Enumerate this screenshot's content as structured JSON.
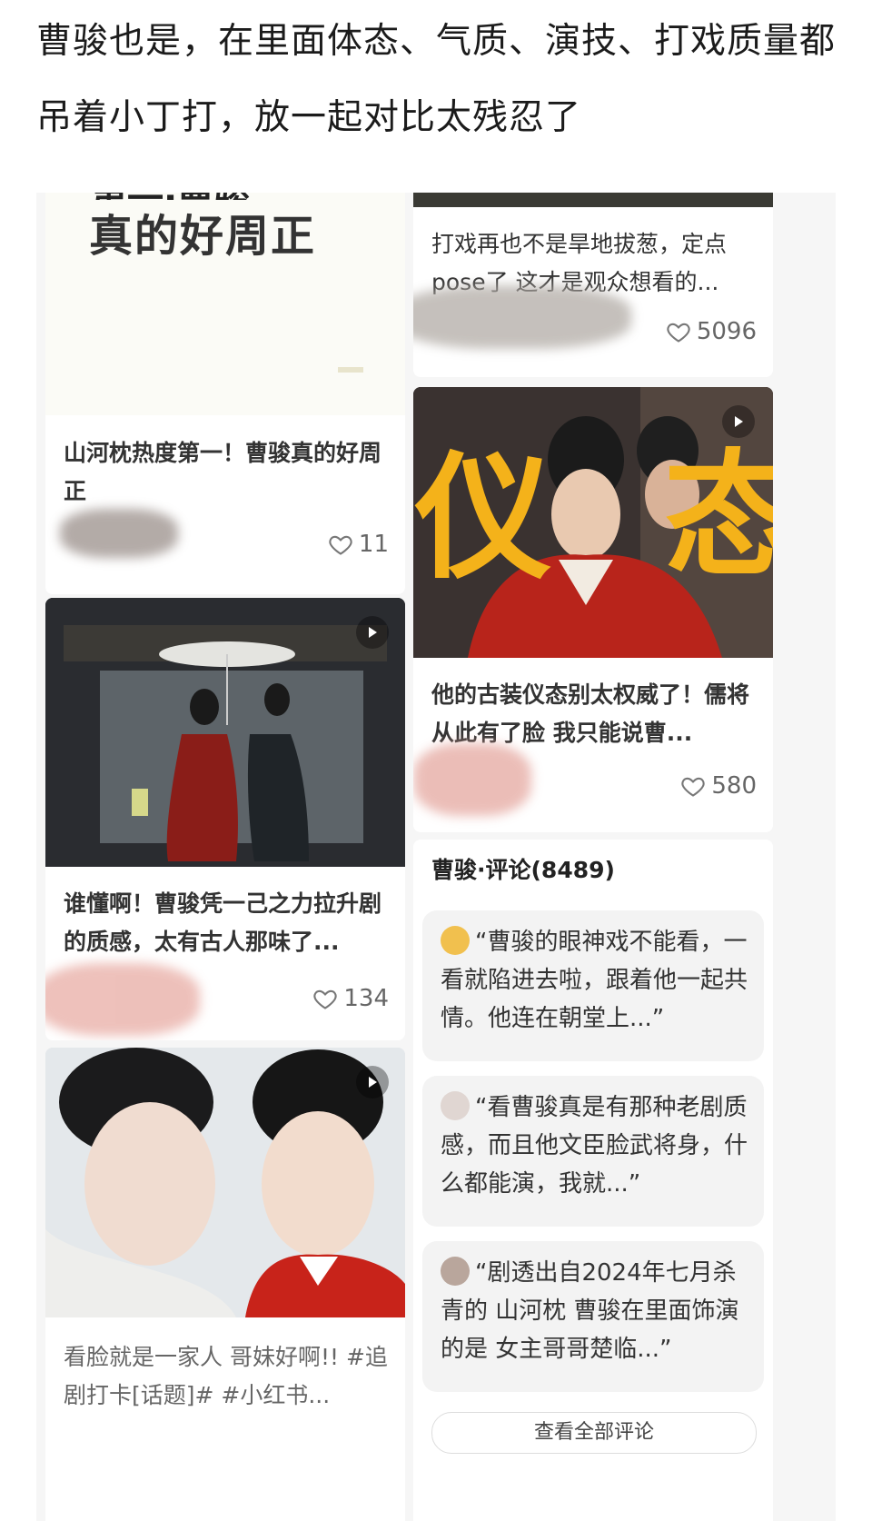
{
  "headline": "曹骏也是，在里面体态、气质、演技、打戏质量都吊着小丁打，放一起对比太残忍了",
  "cards": {
    "c1": {
      "overlay_top": "第一·曹骏",
      "overlay_main": "真的好周正",
      "title": "山河枕热度第一！曹骏真的好周正",
      "likes": "11"
    },
    "c2": {
      "title": "打戏再也不是旱地拔葱，定点pose了 这才是观众想看的...",
      "likes": "5096"
    },
    "c3": {
      "overlay_left": "仪",
      "overlay_right": "态",
      "title": "他的古装仪态别太权威了！儒将从此有了脸 我只能说曹...",
      "likes": "580"
    },
    "c4": {
      "title": "谁懂啊！曹骏凭一己之力拉升剧的质感，太有古人那味了...",
      "likes": "134"
    },
    "c5": {
      "title": "看脸就是一家人 哥妹好啊!! #追剧打卡[话题]# #小红书..."
    }
  },
  "comments": {
    "header": "曹骏·评论(8489)",
    "items": [
      {
        "text": "“曹骏的眼神戏不能看，一看就陷进去啦，跟着他一起共情。他连在朝堂上...”"
      },
      {
        "text": "“看曹骏真是有那种老剧质感，而且他文臣脸武将身，什么都能演，我就...”"
      },
      {
        "text": "“剧透出自2024年七月杀青的 山河枕 曹骏在里面饰演的是 女主哥哥楚临...”"
      }
    ],
    "view_all": "查看全部评论"
  }
}
